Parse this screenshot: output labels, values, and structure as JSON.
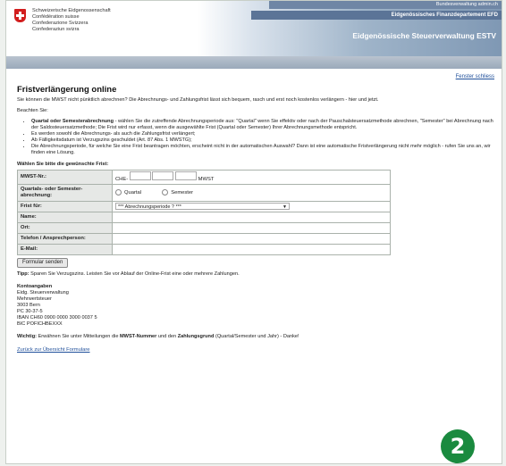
{
  "header": {
    "confederation_lines": [
      "Schweizerische Eidgenossenschaft",
      "Confédération suisse",
      "Confederazione Svizzera",
      "Confederaziun svizra"
    ],
    "top_text": "Bundesverwaltung admin.ch",
    "department": "Eidgenössisches Finanzdepartement EFD",
    "office": "Eidgenössische Steuerverwaltung ESTV"
  },
  "close_link": "Fenster schliess",
  "page_title": "Fristverlängerung online",
  "intro": "Sie können die MWST nicht pünktlich abrechnen? Die Abrechnungs- und Zahlungsfrist lässt sich bequem, rasch und erst noch kostenlos verlängern - hier und jetzt.",
  "note_heading": "Beachten Sie:",
  "notes": [
    {
      "bold": "Quartal oder Semesterabrechnung",
      "text": " - wählen Sie die zutreffende Abrechnungsperiode aus: \"Quartal\" wenn Sie effektiv oder nach der Pauschalsteuersatzmethode abrechnen, \"Semester\" bei Abrechnung nach der Saldosteuersatzmethode; Die Frist wird nur erfasst, wenn die ausgewählte Frist (Quartal oder Semester) Ihrer Abrechnungsmethode entspricht."
    },
    {
      "bold": "",
      "text": "Es werden sowohl die Abrechnungs- als auch die Zahlungsfrist verlängert;"
    },
    {
      "bold": "",
      "text": "Ab Fälligkeitsdatum ist Verzugszins geschuldet (Art. 87 Abs. 1 MWSTG);"
    },
    {
      "bold": "",
      "text": "Die Abrechnungsperiode, für welche Sie eine Frist beantragen möchten, erscheint nicht in der automatischen Auswahl? Dann ist eine automatische Fristverlängerung nicht mehr möglich - rufen Sie uns an, wir finden eine Lösung."
    }
  ],
  "form": {
    "title": "Wählen Sie bitte die gewünschte Frist:",
    "mwst_label": "MWST-Nr.:",
    "mwst_prefix": "CHE-",
    "mwst_suffix": "MWST",
    "period_label": "Quartals- oder Semester-abrechnung:",
    "radio_quarter": "Quartal",
    "radio_semester": "Semester",
    "deadline_label": "Frist für:",
    "deadline_value": "*** Abrechnungsperiode ? ***",
    "name_label": "Name:",
    "ort_label": "Ort:",
    "phone_label": "Telefon / Ansprechperson:",
    "email_label": "E-Mail:",
    "submit": "Formular senden"
  },
  "tip_bold": "Tipp:",
  "tip_text": " Sparen Sie Verzugszins. Leisten Sie vor Ablauf der Online-Frist eine oder mehrere Zahlungen.",
  "account": {
    "title": "Kontoangaben",
    "lines": [
      "Eidg. Steuerverwaltung",
      "Mehrwertsteuer",
      "3003 Bern",
      "PC 30-37-5",
      "IBAN CH60 0900 0000 3000 0037 5",
      "BIC POFICHBEXXX"
    ]
  },
  "important": {
    "bold": "Wichtig:",
    "text1": " Erwähnen Sie unter Mitteilungen die ",
    "mwst": "MWST-Nummer",
    "text2": " und den ",
    "reason": "Zahlungsgrund",
    "text3": " (Quartal/Semester und Jahr) - Danke!"
  },
  "back_link": "Zurück zur Übersicht Formulare",
  "badge": "2"
}
